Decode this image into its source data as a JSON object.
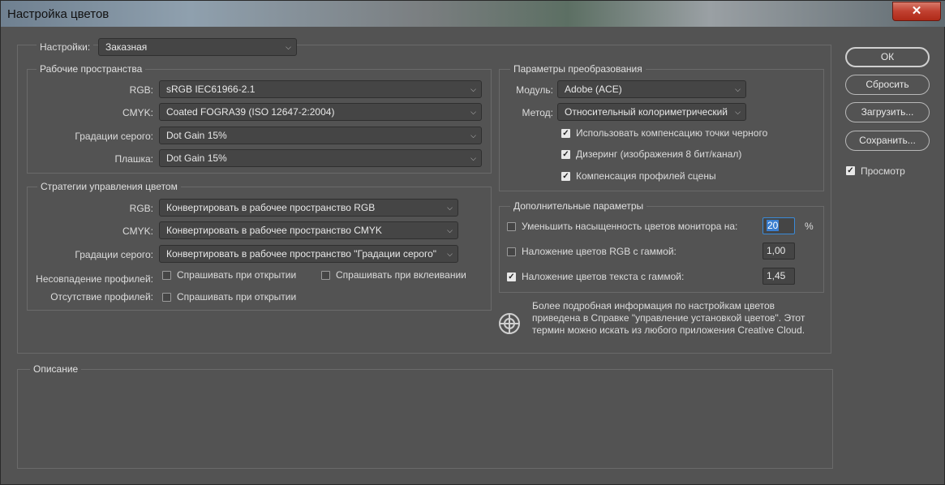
{
  "window": {
    "title": "Настройка цветов",
    "close": "✕"
  },
  "settings": {
    "label": "Настройки:",
    "value": "Заказная"
  },
  "working_spaces": {
    "title": "Рабочие пространства",
    "rgb": {
      "label": "RGB:",
      "value": "sRGB IEC61966-2.1"
    },
    "cmyk": {
      "label": "CMYK:",
      "value": "Coated FOGRA39 (ISO 12647-2:2004)"
    },
    "gray": {
      "label": "Градации серого:",
      "value": "Dot Gain 15%"
    },
    "spot": {
      "label": "Плашка:",
      "value": "Dot Gain 15%"
    }
  },
  "policies": {
    "title": "Стратегии управления цветом",
    "rgb": {
      "label": "RGB:",
      "value": "Конвертировать в рабочее пространство RGB"
    },
    "cmyk": {
      "label": "CMYK:",
      "value": "Конвертировать в рабочее пространство CMYK"
    },
    "gray": {
      "label": "Градации серого:",
      "value": "Конвертировать в рабочее пространство \"Градации серого\""
    },
    "mismatch": {
      "label": "Несовпадение профилей:",
      "ask_open": "Спрашивать при открытии",
      "ask_paste": "Спрашивать при вклеивании"
    },
    "missing": {
      "label": "Отсутствие профилей:",
      "ask_open": "Спрашивать при открытии"
    }
  },
  "conversion": {
    "title": "Параметры преобразования",
    "engine": {
      "label": "Модуль:",
      "value": "Adobe (ACE)"
    },
    "intent": {
      "label": "Метод:",
      "value": "Относительный колориметрический"
    },
    "black_point": "Использовать компенсацию точки черного",
    "dither": "Дизеринг (изображения 8 бит/канал)",
    "scene": "Компенсация профилей сцены"
  },
  "advanced": {
    "title": "Дополнительные параметры",
    "desaturate": {
      "label": "Уменьшить насыщенность цветов монитора на:",
      "value": "20",
      "unit": "%"
    },
    "blend_rgb": {
      "label": "Наложение цветов RGB с гаммой:",
      "value": "1,00"
    },
    "blend_text": {
      "label": "Наложение цветов текста с гаммой:",
      "value": "1,45"
    }
  },
  "info": {
    "line1": "Более подробная информация по настройкам цветов",
    "line2": "приведена в Справке \"управление установкой цветов\". Этот",
    "line3": "термин можно искать из любого приложения Creative Cloud."
  },
  "description": {
    "title": "Описание"
  },
  "buttons": {
    "ok": "ОК",
    "reset": "Сбросить",
    "load": "Загрузить...",
    "save": "Сохранить...",
    "preview": "Просмотр"
  },
  "checks": {
    "on": "✓"
  }
}
